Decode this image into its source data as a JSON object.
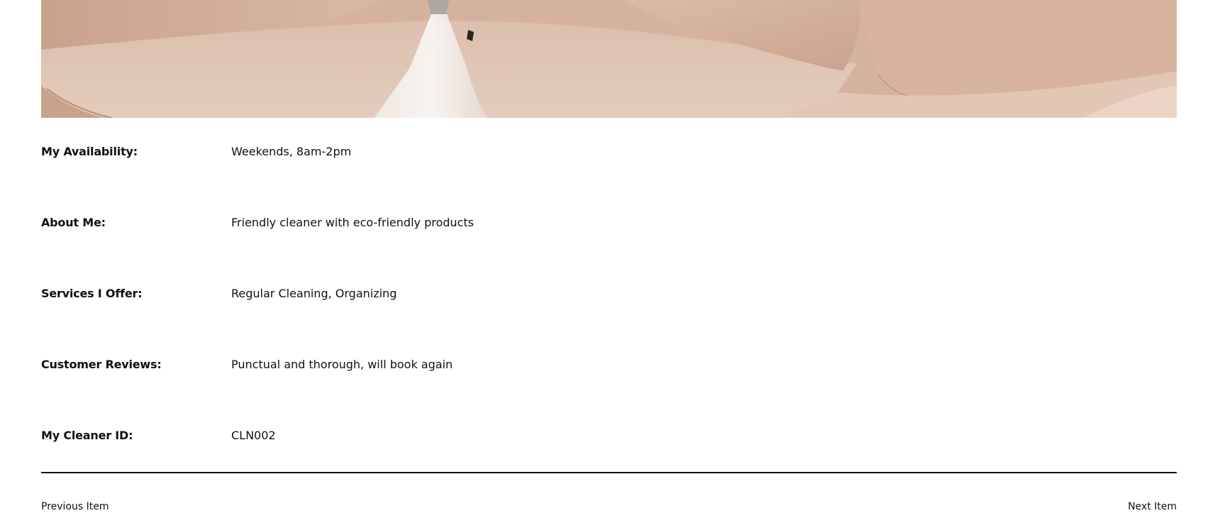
{
  "details": [
    {
      "label": "My Availability:",
      "value": "Weekends, 8am-2pm"
    },
    {
      "label": "About Me:",
      "value": "Friendly cleaner with eco-friendly products"
    },
    {
      "label": "Services I Offer:",
      "value": "Regular Cleaning, Organizing"
    },
    {
      "label": "Customer Reviews:",
      "value": "Punctual and thorough, will book again"
    },
    {
      "label": "My Cleaner ID:",
      "value": "CLN002"
    }
  ],
  "navigation": {
    "previous_label": "Previous Item",
    "next_label": "Next Item"
  },
  "colors": {
    "sofa": "#d9b9a5",
    "text": "#111111",
    "divider": "#111111",
    "background": "#ffffff"
  }
}
